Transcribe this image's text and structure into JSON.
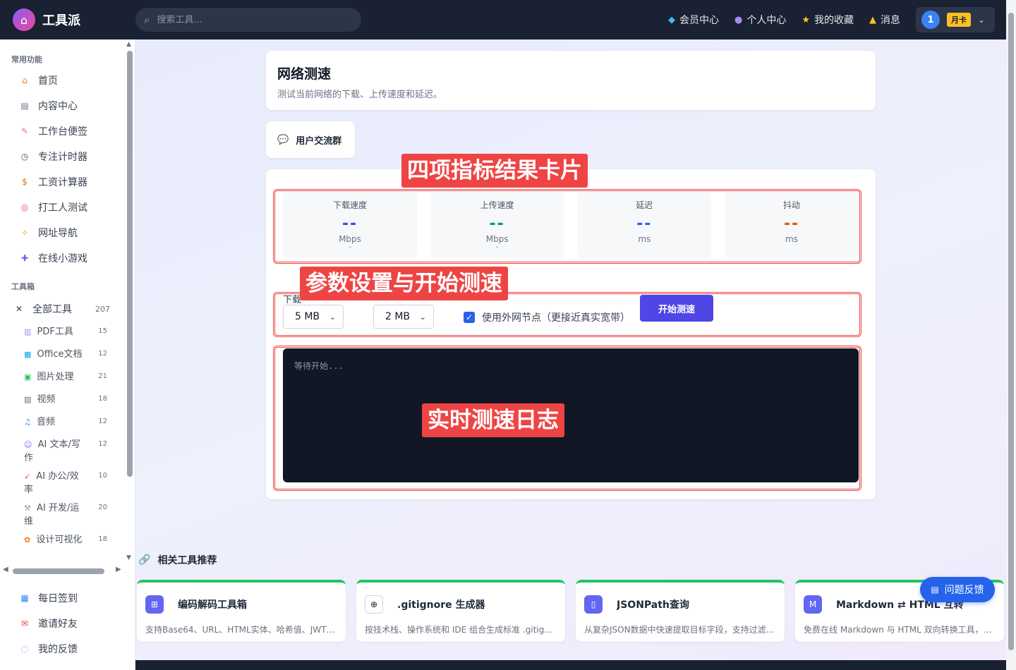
{
  "app": {
    "name": "工具派"
  },
  "search": {
    "placeholder": "搜索工具..."
  },
  "nav": {
    "member": "会员中心",
    "profile": "个人中心",
    "favorites": "我的收藏",
    "messages": "消息",
    "user_avatar": "1",
    "vip_badge": "月卡"
  },
  "sidebar": {
    "section_common": "常用功能",
    "common_items": [
      {
        "label": "首页",
        "icon": "home-icon"
      },
      {
        "label": "内容中心",
        "icon": "news-icon"
      },
      {
        "label": "工作台便签",
        "icon": "memo-icon"
      },
      {
        "label": "专注计时器",
        "icon": "timer-icon"
      },
      {
        "label": "工资计算器",
        "icon": "money-bag-icon"
      },
      {
        "label": "打工人测试",
        "icon": "target-icon"
      },
      {
        "label": "网址导航",
        "icon": "compass-icon"
      },
      {
        "label": "在线小游戏",
        "icon": "gamepad-icon"
      }
    ],
    "section_tools": "工具箱",
    "all_tools": {
      "label": "全部工具",
      "count": "207"
    },
    "tool_categories": [
      {
        "label": "PDF工具",
        "count": "15",
        "icon": "pdf-icon"
      },
      {
        "label": "Office文档",
        "count": "12",
        "icon": "office-icon"
      },
      {
        "label": "图片处理",
        "count": "21",
        "icon": "image-icon"
      },
      {
        "label": "视频",
        "count": "18",
        "icon": "clapper-icon"
      },
      {
        "label": "音频",
        "count": "12",
        "icon": "music-icon"
      },
      {
        "label": "AI 文本/写作",
        "count": "12",
        "icon": "robot-icon"
      },
      {
        "label": "AI 办公/效率",
        "count": "10",
        "icon": "rocket-icon"
      },
      {
        "label": "AI 开发/运维",
        "count": "20",
        "icon": "wrench-icon"
      },
      {
        "label": "设计可视化",
        "count": "18",
        "icon": "palette-icon"
      }
    ],
    "bottom_items": [
      {
        "label": "每日签到",
        "icon": "calendar-icon"
      },
      {
        "label": "邀请好友",
        "icon": "gift-icon"
      },
      {
        "label": "我的反馈",
        "icon": "speech-bubble-icon"
      }
    ]
  },
  "page": {
    "title": "网络测速",
    "subtitle": "测试当前网络的下载、上传速度和延迟。",
    "group_link": "用户交流群"
  },
  "metrics": [
    {
      "label": "下载速度",
      "value": "--",
      "unit": "Mbps",
      "sub": "-",
      "color": "#4f46e5"
    },
    {
      "label": "上传速度",
      "value": "--",
      "unit": "Mbps",
      "sub": "-",
      "color": "#059669"
    },
    {
      "label": "延迟",
      "value": "--",
      "unit": "ms",
      "sub": "",
      "color": "#2563eb"
    },
    {
      "label": "抖动",
      "value": "--",
      "unit": "ms",
      "sub": "",
      "color": "#ea580c"
    }
  ],
  "controls": {
    "param_label_visible": "下载",
    "download_size": "5 MB",
    "upload_size": "2 MB",
    "external_node_label": "使用外网节点（更接近真实宽带）",
    "external_node_checked": true,
    "start_button": "开始测速"
  },
  "log": {
    "placeholder": "等待开始..."
  },
  "annotations": {
    "metrics_card": "四项指标结果卡片",
    "params_start": "参数设置与开始测速",
    "realtime_log": "实时测速日志"
  },
  "related": {
    "heading": "相关工具推荐",
    "items": [
      {
        "name": "编码解码工具箱",
        "desc": "支持Base64、URL、HTML实体、哈希值、JWT、...",
        "icon": "encode-icon",
        "color": "#6366f1"
      },
      {
        "name": ".gitignore 生成器",
        "desc": "按技术栈、操作系统和 IDE 组合生成标准 .gitigno...",
        "icon": "file-plus-icon",
        "color": "#ffffff"
      },
      {
        "name": "JSONPath查询",
        "desc": "从复杂JSON数据中快速提取目标字段，支持过滤...",
        "icon": "clipboard-icon",
        "color": "#6366f1"
      },
      {
        "name": "Markdown ⇄ HTML 互转",
        "desc": "免费在线 Markdown 与 HTML 双向转换工具，支...",
        "icon": "markdown-icon",
        "color": "#6366f1"
      }
    ]
  },
  "feedback": {
    "label": "问题反馈"
  }
}
